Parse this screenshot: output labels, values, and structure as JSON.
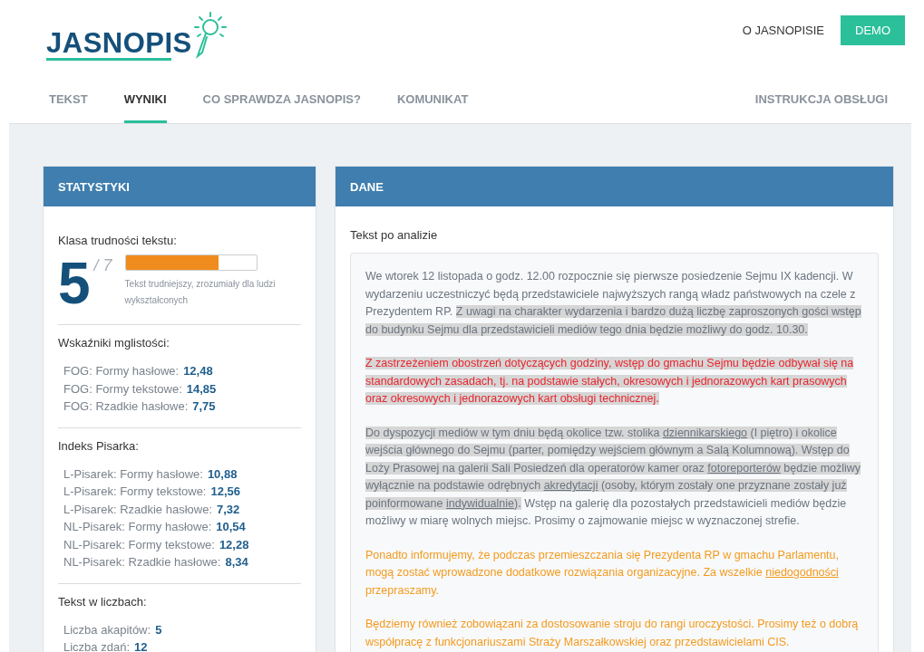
{
  "logo": {
    "text": "JASNOPIS"
  },
  "top_links": [
    {
      "label": "O JASNOPISIE",
      "kind": "link"
    },
    {
      "label": "DEMO",
      "kind": "button"
    }
  ],
  "tabs": [
    {
      "label": "TEKST",
      "selected": false
    },
    {
      "label": "WYNIKI",
      "selected": true
    },
    {
      "label": "CO SPRAWDZA JASNOPIS?",
      "selected": false
    },
    {
      "label": "KOMUNIKAT",
      "selected": false
    }
  ],
  "help_tab": {
    "label": "INSTRUKCJA OBSŁUGI"
  },
  "stats": {
    "title": "STATYSTYKI",
    "difficulty": {
      "title": "Klasa trudności tekstu:",
      "grade": "5",
      "max": "/ 7",
      "level": 0.71,
      "description": "Tekst trudniejszy, zrozumiały dla ludzi wykształconych"
    },
    "sections": [
      {
        "title": "Wskaźniki mglistości:",
        "rows": [
          {
            "label": "FOG: Formy hasłowe:",
            "value": "12,48"
          },
          {
            "label": "FOG: Formy tekstowe:",
            "value": "14,85"
          },
          {
            "label": "FOG: Rzadkie hasłowe:",
            "value": "7,75"
          }
        ]
      },
      {
        "title": "Indeks Pisarka:",
        "rows": [
          {
            "label": "L-Pisarek: Formy hasłowe:",
            "value": "10,88"
          },
          {
            "label": "L-Pisarek: Formy tekstowe:",
            "value": "12,56"
          },
          {
            "label": "L-Pisarek: Rzadkie hasłowe:",
            "value": "7,32"
          },
          {
            "label": "NL-Pisarek: Formy hasłowe:",
            "value": "10,54"
          },
          {
            "label": "NL-Pisarek: Formy tekstowe:",
            "value": "12,28"
          },
          {
            "label": "NL-Pisarek: Rzadkie hasłowe:",
            "value": "8,34"
          }
        ]
      },
      {
        "title": "Tekst w liczbach:",
        "rows": [
          {
            "label": "Liczba akapitów:",
            "value": "5"
          },
          {
            "label": "Liczba zdań:",
            "value": "12"
          }
        ]
      }
    ]
  },
  "data": {
    "title": "DANE",
    "label": "Tekst po analizie",
    "paragraphs": [
      {
        "color": "#6b7480",
        "segments": [
          {
            "highlighted": false,
            "parts": [
              {
                "text": "We wtorek 12 listopada o godz. 12.00 rozpocznie się pierwsze posiedzenie Sejmu IX kadencji. W wydarzeniu uczestniczyć będą przedstawiciele najwyższych rangą władz państwowych na czele z Prezydentem RP. ",
                "underlined": false
              }
            ]
          },
          {
            "highlighted": true,
            "parts": [
              {
                "text": "Z uwagi na charakter wydarzenia i bardzo dużą liczbę zaproszonych gości wstęp do budynku Sejmu dla przedstawicieli mediów tego dnia będzie możliwy do godz. 10.30.",
                "underlined": false
              }
            ]
          }
        ]
      },
      {
        "color": "#e8262e",
        "segments": [
          {
            "highlighted": true,
            "parts": [
              {
                "text": "Z zastrzeżeniem obostrzeń dotyczących godziny, wstęp do gmachu Sejmu będzie odbywał się na standardowych zasadach, tj. na podstawie stałych, okresowych i jednorazowych kart prasowych oraz okresowych i jednorazowych kart obsługi technicznej.",
                "underlined": false
              }
            ]
          }
        ]
      },
      {
        "color": "#6b7480",
        "segments": [
          {
            "highlighted": true,
            "parts": [
              {
                "text": "Do dyspozycji mediów w tym dniu będą okolice tzw. stolika ",
                "underlined": false
              },
              {
                "text": "dziennikarskiego",
                "underlined": true
              },
              {
                "text": " (I piętro) i okolice wejścia głównego do Sejmu (parter, pomiędzy wejściem głównym a Salą Kolumnową). ",
                "underlined": false
              }
            ]
          },
          {
            "highlighted": true,
            "parts": [
              {
                "text": "Wstęp do Loży Prasowej na galerii Sali Posiedzeń dla operatorów kamer oraz ",
                "underlined": false
              },
              {
                "text": "fotoreporterów",
                "underlined": true
              },
              {
                "text": " będzie możliwy wyłącznie na podstawie odrębnych ",
                "underlined": false
              },
              {
                "text": "akredytacji",
                "underlined": true
              },
              {
                "text": " (osoby, którym zostały one przyznane zostały już poinformowane ",
                "underlined": false
              },
              {
                "text": "indywidualnie",
                "underlined": true
              },
              {
                "text": ").",
                "underlined": false
              }
            ]
          },
          {
            "highlighted": false,
            "parts": [
              {
                "text": " Wstęp na galerię dla pozostałych przedstawicieli mediów będzie możliwy w miarę wolnych miejsc. Prosimy o zajmowanie miejsc w wyznaczonej strefie.",
                "underlined": false
              }
            ]
          }
        ]
      },
      {
        "color": "#f39a1e",
        "segments": [
          {
            "highlighted": false,
            "parts": [
              {
                "text": "Ponadto informujemy, że podczas przemieszczania się Prezydenta RP w gmachu Parlamentu, mogą zostać wprowadzone dodatkowe rozwiązania organizacyjne. Za wszelkie ",
                "underlined": false
              },
              {
                "text": "niedogodności",
                "underlined": true
              },
              {
                "text": " przepraszamy.",
                "underlined": false
              }
            ]
          }
        ]
      },
      {
        "color": "#f39a1e",
        "segments": [
          {
            "highlighted": false,
            "parts": [
              {
                "text": "Będziemy również zobowiązani za dostosowanie stroju do rangi uroczystości. Prosimy też o dobrą współpracę z funkcjonariuszami Straży Marszałkowskiej oraz przedstawicielami CIS.",
                "underlined": false
              }
            ]
          }
        ]
      }
    ]
  }
}
